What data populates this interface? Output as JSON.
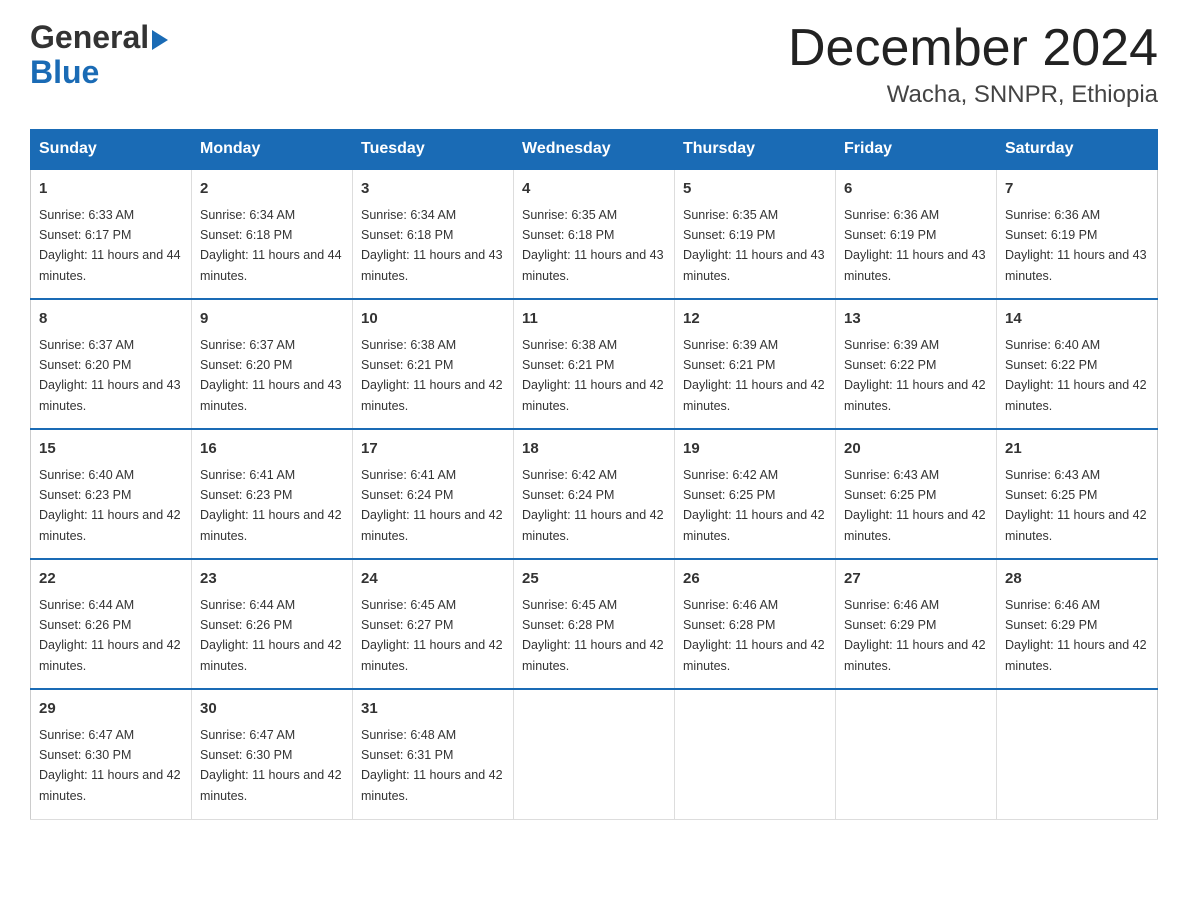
{
  "logo": {
    "text_general": "General",
    "text_blue": "Blue",
    "alt": "GeneralBlue logo"
  },
  "header": {
    "month_year": "December 2024",
    "location": "Wacha, SNNPR, Ethiopia"
  },
  "weekdays": [
    "Sunday",
    "Monday",
    "Tuesday",
    "Wednesday",
    "Thursday",
    "Friday",
    "Saturday"
  ],
  "weeks": [
    [
      {
        "day": "1",
        "sunrise": "6:33 AM",
        "sunset": "6:17 PM",
        "daylight": "11 hours and 44 minutes."
      },
      {
        "day": "2",
        "sunrise": "6:34 AM",
        "sunset": "6:18 PM",
        "daylight": "11 hours and 44 minutes."
      },
      {
        "day": "3",
        "sunrise": "6:34 AM",
        "sunset": "6:18 PM",
        "daylight": "11 hours and 43 minutes."
      },
      {
        "day": "4",
        "sunrise": "6:35 AM",
        "sunset": "6:18 PM",
        "daylight": "11 hours and 43 minutes."
      },
      {
        "day": "5",
        "sunrise": "6:35 AM",
        "sunset": "6:19 PM",
        "daylight": "11 hours and 43 minutes."
      },
      {
        "day": "6",
        "sunrise": "6:36 AM",
        "sunset": "6:19 PM",
        "daylight": "11 hours and 43 minutes."
      },
      {
        "day": "7",
        "sunrise": "6:36 AM",
        "sunset": "6:19 PM",
        "daylight": "11 hours and 43 minutes."
      }
    ],
    [
      {
        "day": "8",
        "sunrise": "6:37 AM",
        "sunset": "6:20 PM",
        "daylight": "11 hours and 43 minutes."
      },
      {
        "day": "9",
        "sunrise": "6:37 AM",
        "sunset": "6:20 PM",
        "daylight": "11 hours and 43 minutes."
      },
      {
        "day": "10",
        "sunrise": "6:38 AM",
        "sunset": "6:21 PM",
        "daylight": "11 hours and 42 minutes."
      },
      {
        "day": "11",
        "sunrise": "6:38 AM",
        "sunset": "6:21 PM",
        "daylight": "11 hours and 42 minutes."
      },
      {
        "day": "12",
        "sunrise": "6:39 AM",
        "sunset": "6:21 PM",
        "daylight": "11 hours and 42 minutes."
      },
      {
        "day": "13",
        "sunrise": "6:39 AM",
        "sunset": "6:22 PM",
        "daylight": "11 hours and 42 minutes."
      },
      {
        "day": "14",
        "sunrise": "6:40 AM",
        "sunset": "6:22 PM",
        "daylight": "11 hours and 42 minutes."
      }
    ],
    [
      {
        "day": "15",
        "sunrise": "6:40 AM",
        "sunset": "6:23 PM",
        "daylight": "11 hours and 42 minutes."
      },
      {
        "day": "16",
        "sunrise": "6:41 AM",
        "sunset": "6:23 PM",
        "daylight": "11 hours and 42 minutes."
      },
      {
        "day": "17",
        "sunrise": "6:41 AM",
        "sunset": "6:24 PM",
        "daylight": "11 hours and 42 minutes."
      },
      {
        "day": "18",
        "sunrise": "6:42 AM",
        "sunset": "6:24 PM",
        "daylight": "11 hours and 42 minutes."
      },
      {
        "day": "19",
        "sunrise": "6:42 AM",
        "sunset": "6:25 PM",
        "daylight": "11 hours and 42 minutes."
      },
      {
        "day": "20",
        "sunrise": "6:43 AM",
        "sunset": "6:25 PM",
        "daylight": "11 hours and 42 minutes."
      },
      {
        "day": "21",
        "sunrise": "6:43 AM",
        "sunset": "6:25 PM",
        "daylight": "11 hours and 42 minutes."
      }
    ],
    [
      {
        "day": "22",
        "sunrise": "6:44 AM",
        "sunset": "6:26 PM",
        "daylight": "11 hours and 42 minutes."
      },
      {
        "day": "23",
        "sunrise": "6:44 AM",
        "sunset": "6:26 PM",
        "daylight": "11 hours and 42 minutes."
      },
      {
        "day": "24",
        "sunrise": "6:45 AM",
        "sunset": "6:27 PM",
        "daylight": "11 hours and 42 minutes."
      },
      {
        "day": "25",
        "sunrise": "6:45 AM",
        "sunset": "6:28 PM",
        "daylight": "11 hours and 42 minutes."
      },
      {
        "day": "26",
        "sunrise": "6:46 AM",
        "sunset": "6:28 PM",
        "daylight": "11 hours and 42 minutes."
      },
      {
        "day": "27",
        "sunrise": "6:46 AM",
        "sunset": "6:29 PM",
        "daylight": "11 hours and 42 minutes."
      },
      {
        "day": "28",
        "sunrise": "6:46 AM",
        "sunset": "6:29 PM",
        "daylight": "11 hours and 42 minutes."
      }
    ],
    [
      {
        "day": "29",
        "sunrise": "6:47 AM",
        "sunset": "6:30 PM",
        "daylight": "11 hours and 42 minutes."
      },
      {
        "day": "30",
        "sunrise": "6:47 AM",
        "sunset": "6:30 PM",
        "daylight": "11 hours and 42 minutes."
      },
      {
        "day": "31",
        "sunrise": "6:48 AM",
        "sunset": "6:31 PM",
        "daylight": "11 hours and 42 minutes."
      },
      null,
      null,
      null,
      null
    ]
  ]
}
